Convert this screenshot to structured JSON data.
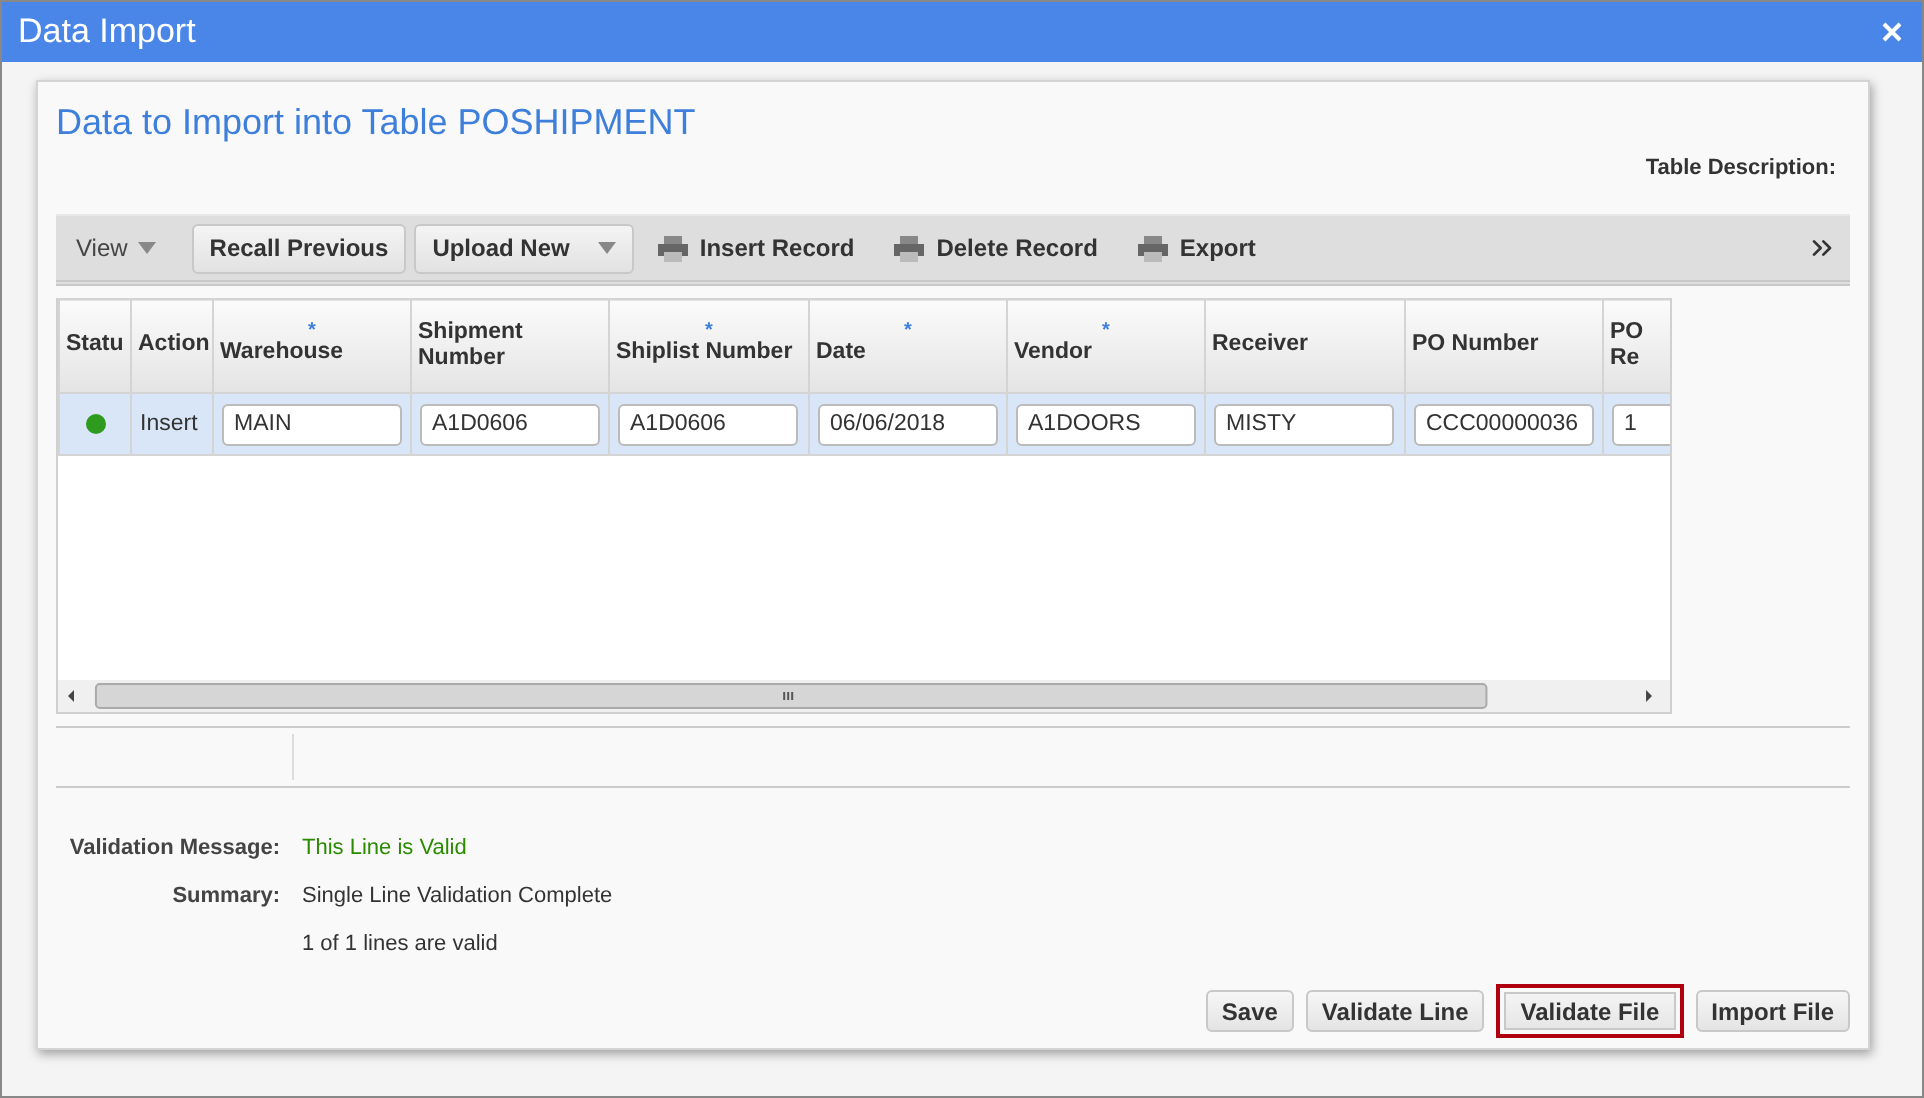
{
  "window": {
    "title": "Data Import"
  },
  "panel": {
    "title": "Data to Import into Table POSHIPMENT",
    "description_label": "Table Description:"
  },
  "toolbar": [
    {
      "kind": "menu",
      "label": "View"
    },
    {
      "kind": "button",
      "label": "Recall Previous"
    },
    {
      "kind": "dropdown",
      "label": "Upload New"
    },
    {
      "kind": "insert",
      "label": "Insert Record"
    },
    {
      "kind": "delete",
      "label": "Delete Record"
    },
    {
      "kind": "export",
      "label": "Export"
    }
  ],
  "table": {
    "columns": [
      {
        "label": "Statu"
      },
      {
        "label": "Action"
      },
      {
        "label": "Warehouse",
        "mark": "*"
      },
      {
        "label": "Shipment Number"
      },
      {
        "label": "Shiplist Number",
        "mark": "*"
      },
      {
        "label": "Date",
        "mark": "*"
      },
      {
        "label": "Vendor",
        "mark": "*"
      },
      {
        "label": "Receiver"
      },
      {
        "label": "PO Number"
      },
      {
        "label": "PO Re"
      }
    ],
    "rows": [
      {
        "selected": true,
        "color": "#2e9a1e",
        "action": "Insert",
        "values": [
          "MAIN",
          "A1D0606",
          "A1D0606",
          "06/06/2018",
          "A1DOORS",
          "MISTY",
          "CCC00000036",
          "1"
        ]
      }
    ]
  },
  "validation": [
    {
      "label": "Validation Message:",
      "value": "This Line is Valid",
      "kind": "success"
    },
    {
      "label": "Summary:",
      "value": "Single Line Validation Complete",
      "kind": "plain"
    },
    {
      "value": "1 of 1 lines are valid",
      "kind": "plain"
    }
  ],
  "buttons": [
    {
      "label": "Save",
      "highlighted": false
    },
    {
      "label": "Validate Line",
      "highlighted": false
    },
    {
      "label": "Validate File",
      "highlighted": true
    },
    {
      "label": "Import File",
      "highlighted": false
    }
  ]
}
